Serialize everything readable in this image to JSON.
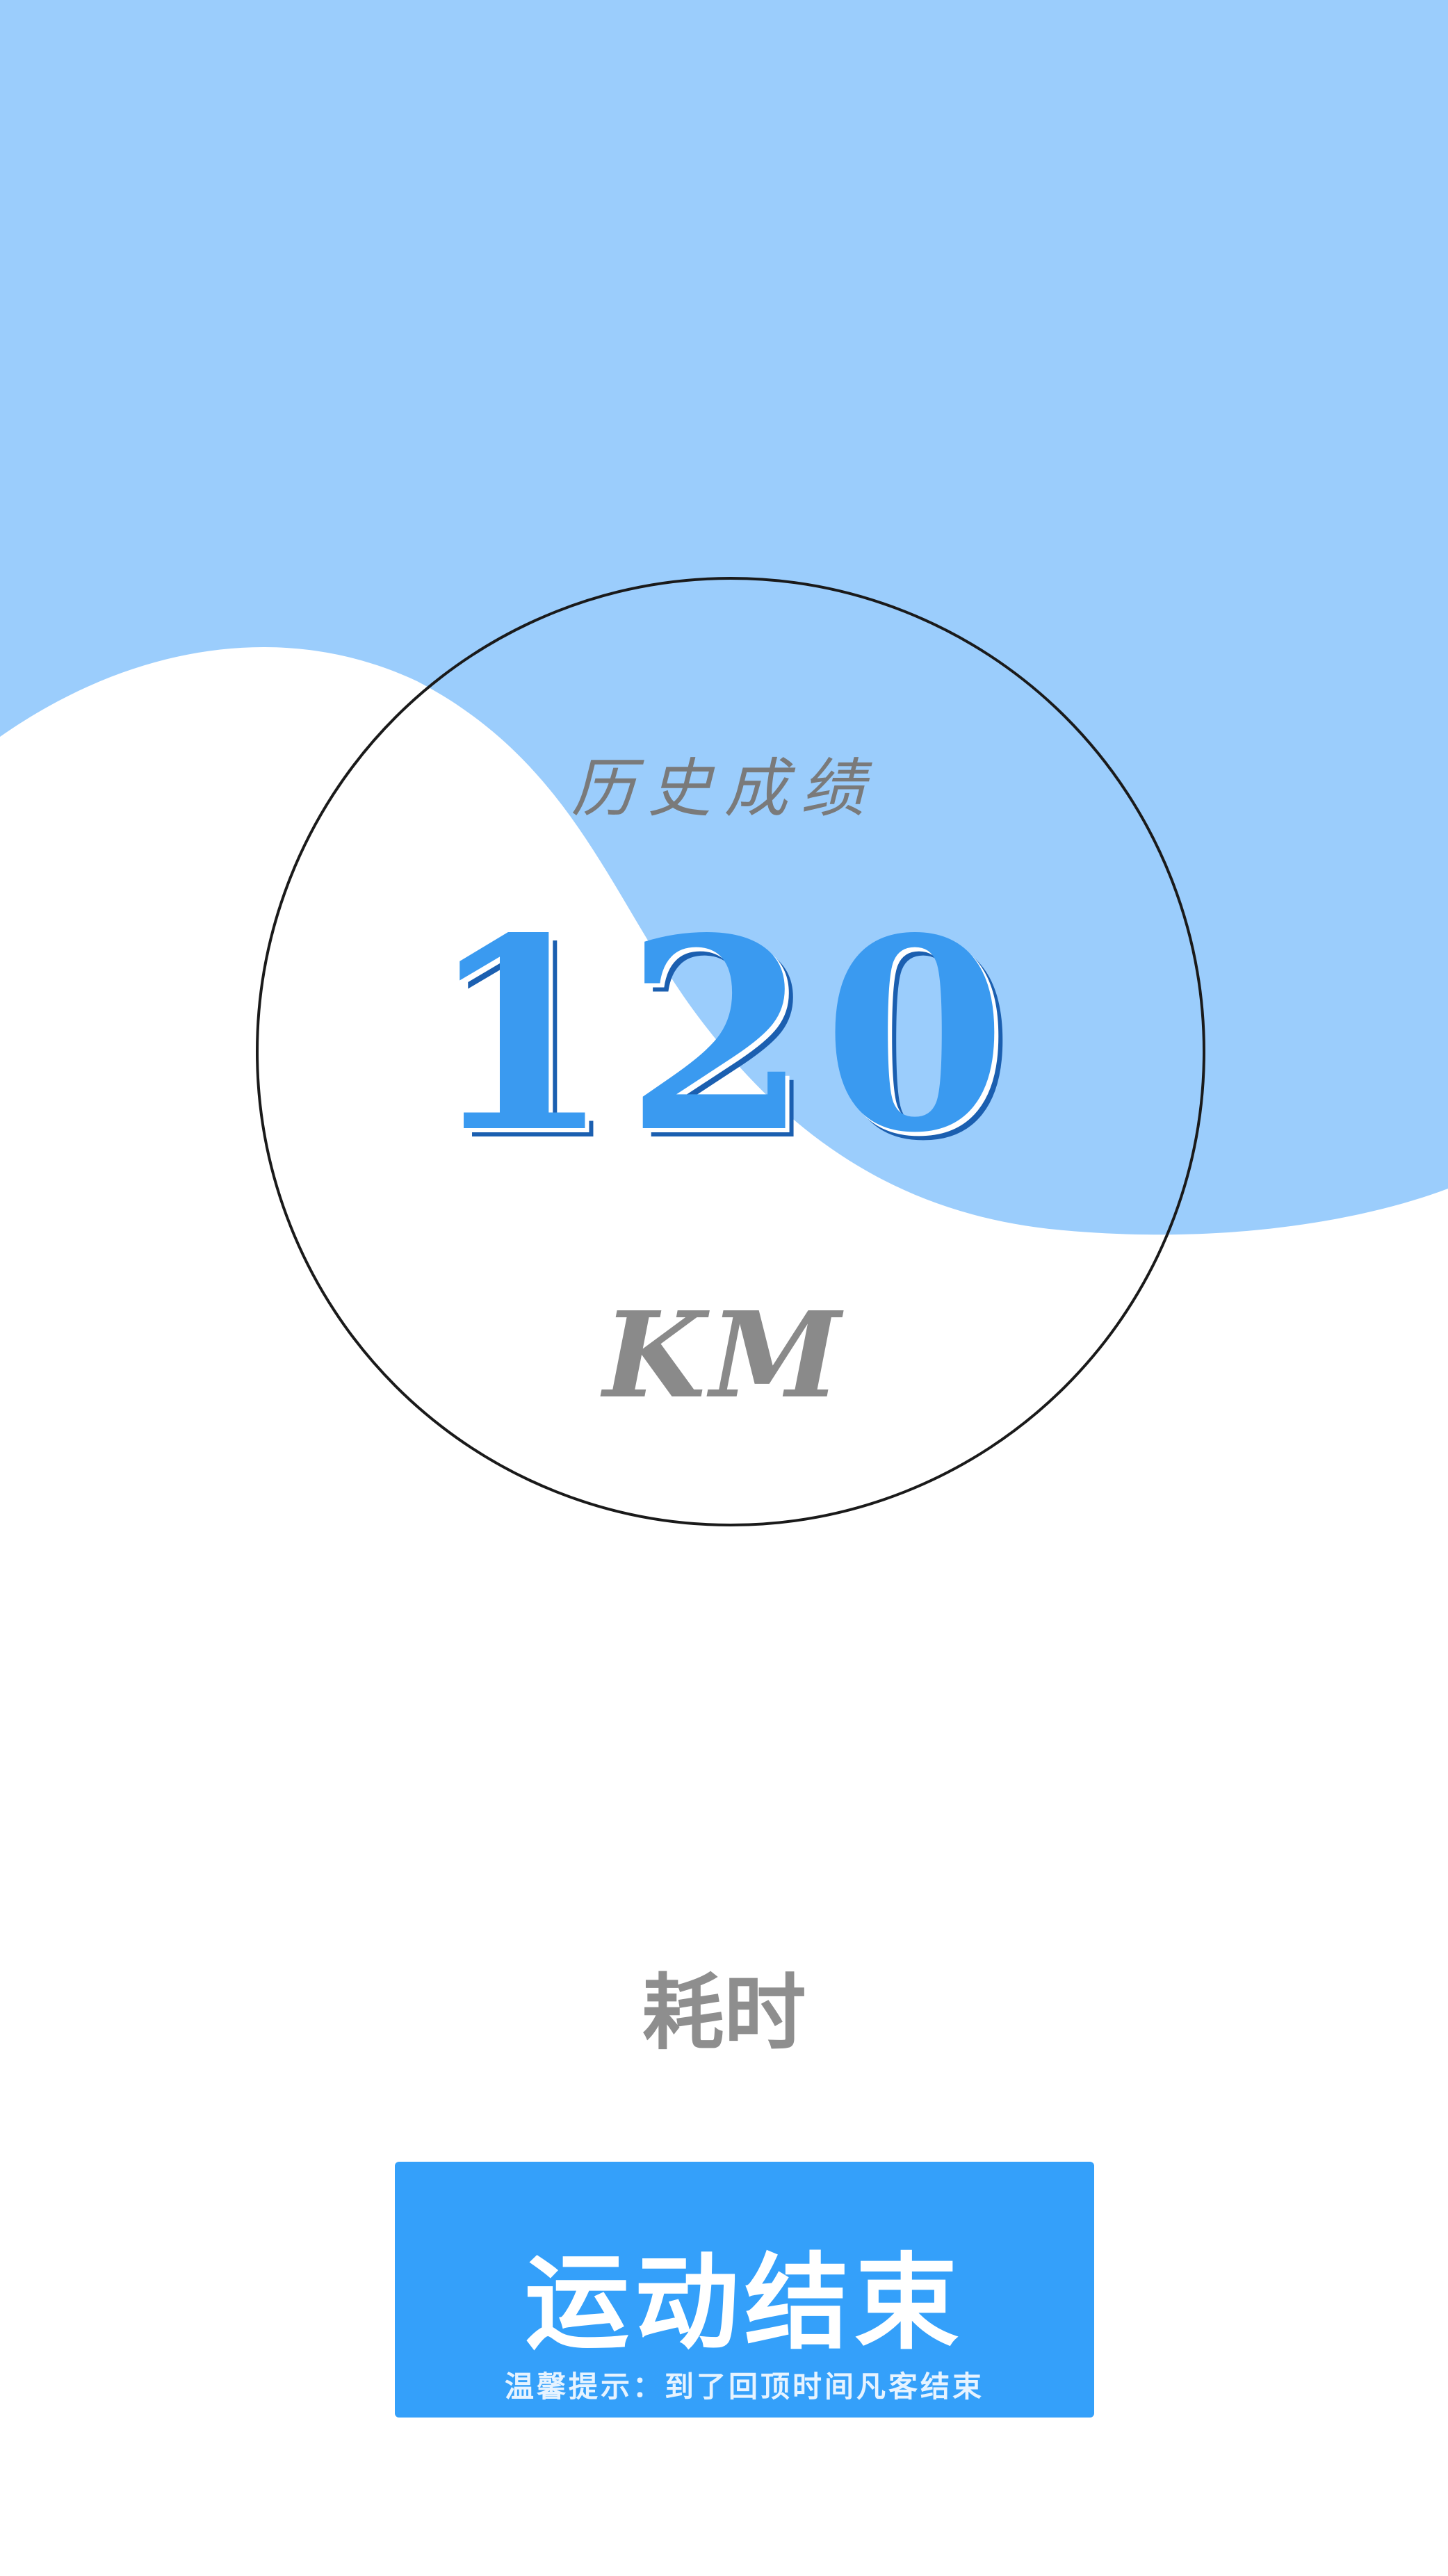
{
  "colors": {
    "sky_blue": "#9bcdfc",
    "accent_blue": "#3a9af0",
    "button_blue": "#34a0fa",
    "ring_stroke": "#1a1a1a",
    "muted_gray": "#8e8e8e"
  },
  "history": {
    "label": "历史成绩",
    "distance_value": "120",
    "distance_unit": "KM"
  },
  "elapsed": {
    "label": "耗时"
  },
  "end_button": {
    "label": "运动结束",
    "hint": "温馨提示：到了回顶时间凡客结束"
  }
}
